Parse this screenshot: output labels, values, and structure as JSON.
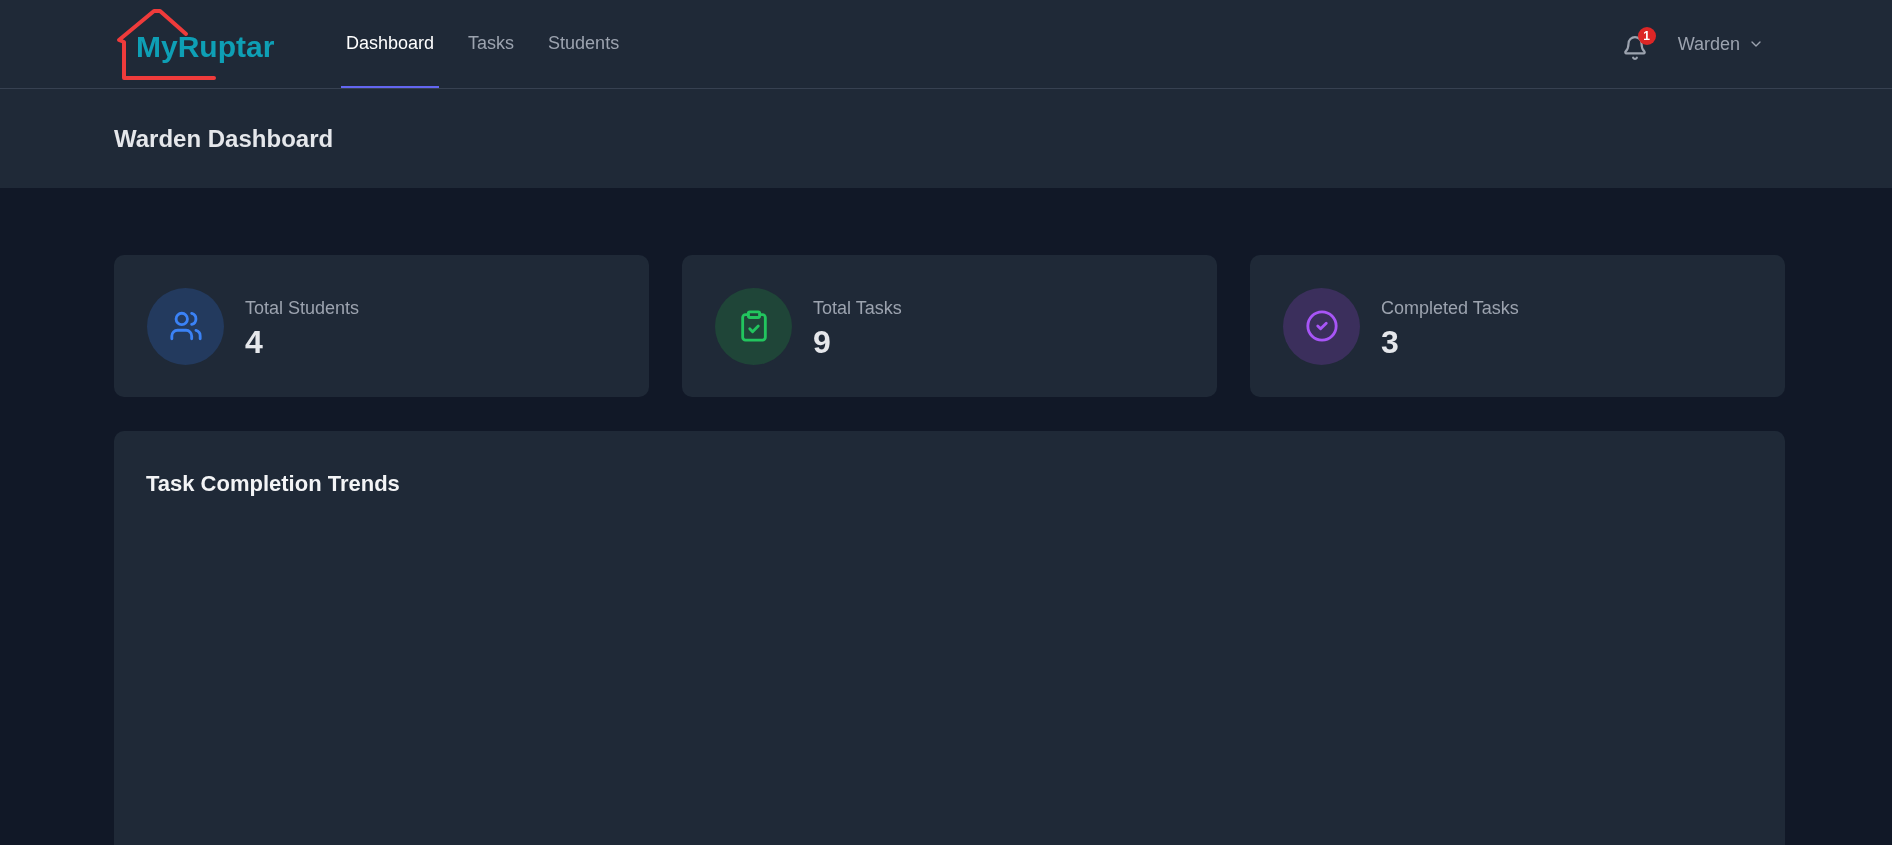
{
  "logo": {
    "text": "MyRuptar"
  },
  "nav": [
    {
      "label": "Dashboard",
      "selected": true
    },
    {
      "label": "Tasks",
      "selected": false
    },
    {
      "label": "Students",
      "selected": false
    }
  ],
  "notifications": {
    "count": "1"
  },
  "user_menu": {
    "label": "Warden"
  },
  "page_title": "Warden Dashboard",
  "stats": [
    {
      "kind": "students",
      "label": "Total Students",
      "value": "4"
    },
    {
      "kind": "tasks",
      "label": "Total Tasks",
      "value": "9"
    },
    {
      "kind": "completed",
      "label": "Completed Tasks",
      "value": "3"
    }
  ],
  "chart_panel": {
    "title": "Task Completion Trends"
  }
}
